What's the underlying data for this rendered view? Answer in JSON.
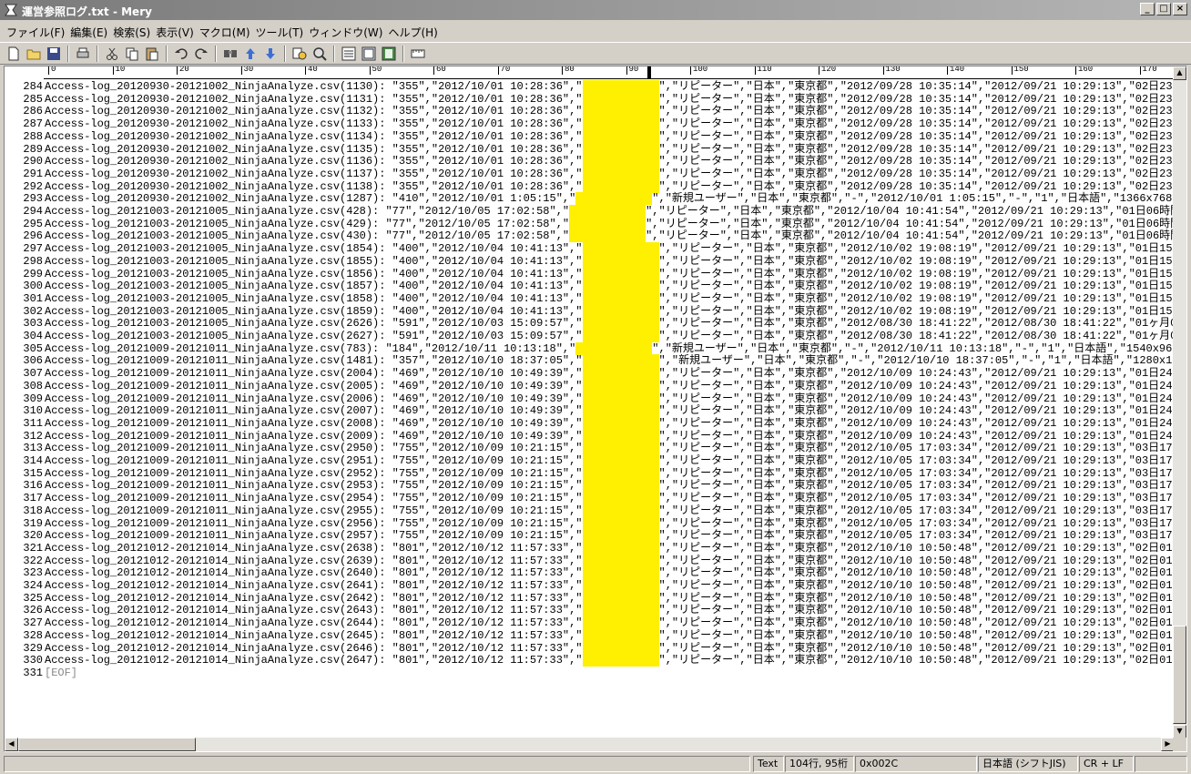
{
  "window": {
    "title": "運営参照ログ.txt - Mery",
    "buttons": [
      "_",
      "□",
      "×"
    ]
  },
  "menu": [
    "ファイル(F)",
    "編集(E)",
    "検索(S)",
    "表示(V)",
    "マクロ(M)",
    "ツール(T)",
    "ウィンドウ(W)",
    "ヘルプ(H)"
  ],
  "toolbar": {
    "icons": [
      "new-file-icon",
      "open-folder-icon",
      "save-icon",
      "print-icon",
      "cut-icon",
      "copy-icon",
      "paste-icon",
      "undo-icon",
      "redo-icon",
      "find-icon",
      "find-prev-icon",
      "find-next-icon",
      "replace-icon",
      "grep-icon",
      "view-icon-1",
      "view-icon-2",
      "view-icon-3",
      "ruler-toggle-icon"
    ]
  },
  "ruler": {
    "labels": [
      "0",
      "10",
      "20",
      "30",
      "40",
      "50",
      "60",
      "70",
      "80",
      "90",
      "100",
      "110",
      "120",
      "130",
      "140",
      "150",
      "160",
      "170"
    ]
  },
  "lines": [
    {
      "no": "284",
      "pre": "Access-log_20120930-20121002_NinjaAnalyze.csv(1130): \"355\",\"2012/10/01 10:28:36\",\"",
      "post": "\",\"リピーター\",\"日本\",\"東京都\",\"2012/09/28 10:35:14\",\"2012/09/21 10:29:13\",\"02日23時"
    },
    {
      "no": "285",
      "pre": "Access-log_20120930-20121002_NinjaAnalyze.csv(1131): \"355\",\"2012/10/01 10:28:36\",\"",
      "post": "\",\"リピーター\",\"日本\",\"東京都\",\"2012/09/28 10:35:14\",\"2012/09/21 10:29:13\",\"02日23時"
    },
    {
      "no": "286",
      "pre": "Access-log_20120930-20121002_NinjaAnalyze.csv(1132): \"355\",\"2012/10/01 10:28:36\",\"",
      "post": "\",\"リピーター\",\"日本\",\"東京都\",\"2012/09/28 10:35:14\",\"2012/09/21 10:29:13\",\"02日23時"
    },
    {
      "no": "287",
      "pre": "Access-log_20120930-20121002_NinjaAnalyze.csv(1133): \"355\",\"2012/10/01 10:28:36\",\"",
      "post": "\",\"リピーター\",\"日本\",\"東京都\",\"2012/09/28 10:35:14\",\"2012/09/21 10:29:13\",\"02日23時"
    },
    {
      "no": "288",
      "pre": "Access-log_20120930-20121002_NinjaAnalyze.csv(1134): \"355\",\"2012/10/01 10:28:36\",\"",
      "post": "\",\"リピーター\",\"日本\",\"東京都\",\"2012/09/28 10:35:14\",\"2012/09/21 10:29:13\",\"02日23時"
    },
    {
      "no": "289",
      "pre": "Access-log_20120930-20121002_NinjaAnalyze.csv(1135): \"355\",\"2012/10/01 10:28:36\",\"",
      "post": "\",\"リピーター\",\"日本\",\"東京都\",\"2012/09/28 10:35:14\",\"2012/09/21 10:29:13\",\"02日23時"
    },
    {
      "no": "290",
      "pre": "Access-log_20120930-20121002_NinjaAnalyze.csv(1136): \"355\",\"2012/10/01 10:28:36\",\"",
      "post": "\",\"リピーター\",\"日本\",\"東京都\",\"2012/09/28 10:35:14\",\"2012/09/21 10:29:13\",\"02日23時"
    },
    {
      "no": "291",
      "pre": "Access-log_20120930-20121002_NinjaAnalyze.csv(1137): \"355\",\"2012/10/01 10:28:36\",\"",
      "post": "\",\"リピーター\",\"日本\",\"東京都\",\"2012/09/28 10:35:14\",\"2012/09/21 10:29:13\",\"02日23時"
    },
    {
      "no": "292",
      "pre": "Access-log_20120930-20121002_NinjaAnalyze.csv(1138): \"355\",\"2012/10/01 10:28:36\",\"",
      "post": "\",\"リピーター\",\"日本\",\"東京都\",\"2012/09/28 10:35:14\",\"2012/09/21 10:29:13\",\"02日23時"
    },
    {
      "no": "293",
      "pre": "Access-log_20120930-20121002_NinjaAnalyze.csv(1287): \"410\",\"2012/10/01 1:05:15\",\"",
      "post": "\",\"新規ユーザー\",\"日本\",\"東京都\",\"-\",\"2012/10/01 1:05:15\",\"-\",\"1\",\"日本語\",\"1366x768"
    },
    {
      "no": "294",
      "pre": "Access-log_20121003-20121005_NinjaAnalyze.csv(428): \"77\",\"2012/10/05 17:02:58\",\"",
      "post": "\",\"リピーター\",\"日本\",\"東京都\",\"2012/10/04 10:41:54\",\"2012/09/21 10:29:13\",\"01日06時間"
    },
    {
      "no": "295",
      "pre": "Access-log_20121003-20121005_NinjaAnalyze.csv(429): \"77\",\"2012/10/05 17:02:58\",\"",
      "post": "\",\"リピーター\",\"日本\",\"東京都\",\"2012/10/04 10:41:54\",\"2012/09/21 10:29:13\",\"01日06時間"
    },
    {
      "no": "296",
      "pre": "Access-log_20121003-20121005_NinjaAnalyze.csv(430): \"77\",\"2012/10/05 17:02:58\",\"",
      "post": "\",\"リピーター\",\"日本\",\"東京都\",\"2012/10/04 10:41:54\",\"2012/09/21 10:29:13\",\"01日06時間"
    },
    {
      "no": "297",
      "pre": "Access-log_20121003-20121005_NinjaAnalyze.csv(1854): \"400\",\"2012/10/04 10:41:13\",\"",
      "post": "\",\"リピーター\",\"日本\",\"東京都\",\"2012/10/02 19:08:19\",\"2012/09/21 10:29:13\",\"01日15時"
    },
    {
      "no": "298",
      "pre": "Access-log_20121003-20121005_NinjaAnalyze.csv(1855): \"400\",\"2012/10/04 10:41:13\",\"",
      "post": "\",\"リピーター\",\"日本\",\"東京都\",\"2012/10/02 19:08:19\",\"2012/09/21 10:29:13\",\"01日15時"
    },
    {
      "no": "299",
      "pre": "Access-log_20121003-20121005_NinjaAnalyze.csv(1856): \"400\",\"2012/10/04 10:41:13\",\"",
      "post": "\",\"リピーター\",\"日本\",\"東京都\",\"2012/10/02 19:08:19\",\"2012/09/21 10:29:13\",\"01日15時"
    },
    {
      "no": "300",
      "pre": "Access-log_20121003-20121005_NinjaAnalyze.csv(1857): \"400\",\"2012/10/04 10:41:13\",\"",
      "post": "\",\"リピーター\",\"日本\",\"東京都\",\"2012/10/02 19:08:19\",\"2012/09/21 10:29:13\",\"01日15時"
    },
    {
      "no": "301",
      "pre": "Access-log_20121003-20121005_NinjaAnalyze.csv(1858): \"400\",\"2012/10/04 10:41:13\",\"",
      "post": "\",\"リピーター\",\"日本\",\"東京都\",\"2012/10/02 19:08:19\",\"2012/09/21 10:29:13\",\"01日15時"
    },
    {
      "no": "302",
      "pre": "Access-log_20121003-20121005_NinjaAnalyze.csv(1859): \"400\",\"2012/10/04 10:41:13\",\"",
      "post": "\",\"リピーター\",\"日本\",\"東京都\",\"2012/10/02 19:08:19\",\"2012/09/21 10:29:13\",\"01日15時"
    },
    {
      "no": "303",
      "pre": "Access-log_20121003-20121005_NinjaAnalyze.csv(2626): \"591\",\"2012/10/03 15:09:57\",\"",
      "post": "\",\"リピーター\",\"日本\",\"東京都\",\"2012/08/30 18:41:22\",\"2012/08/30 18:41:22\",\"01ヶ月0"
    },
    {
      "no": "304",
      "pre": "Access-log_20121003-20121005_NinjaAnalyze.csv(2627): \"591\",\"2012/10/03 15:09:57\",\"",
      "post": "\",\"リピーター\",\"日本\",\"東京都\",\"2012/08/30 18:41:22\",\"2012/08/30 18:41:22\",\"01ヶ月0"
    },
    {
      "no": "305",
      "pre": "Access-log_20121009-20121011_NinjaAnalyze.csv(783): \"184\",\"2012/10/11 10:13:18\",\"",
      "post": "\",\"新規ユーザー\",\"日本\",\"東京都\",\"-\",\"2012/10/11 10:13:18\",\"-\",\"1\",\"日本語\",\"1540x96"
    },
    {
      "no": "306",
      "pre": "Access-log_20121009-20121011_NinjaAnalyze.csv(1481): \"357\",\"2012/10/10 18:37:05\",\"",
      "post": "\",\"新規ユーザー\",\"日本\",\"東京都\",\"-\",\"2012/10/10 18:37:05\",\"-\",\"1\",\"日本語\",\"1280x1"
    },
    {
      "no": "307",
      "pre": "Access-log_20121009-20121011_NinjaAnalyze.csv(2004): \"469\",\"2012/10/10 10:49:39\",\"",
      "post": "\",\"リピーター\",\"日本\",\"東京都\",\"2012/10/09 10:24:43\",\"2012/09/21 10:29:13\",\"01日24分"
    },
    {
      "no": "308",
      "pre": "Access-log_20121009-20121011_NinjaAnalyze.csv(2005): \"469\",\"2012/10/10 10:49:39\",\"",
      "post": "\",\"リピーター\",\"日本\",\"東京都\",\"2012/10/09 10:24:43\",\"2012/09/21 10:29:13\",\"01日24分"
    },
    {
      "no": "309",
      "pre": "Access-log_20121009-20121011_NinjaAnalyze.csv(2006): \"469\",\"2012/10/10 10:49:39\",\"",
      "post": "\",\"リピーター\",\"日本\",\"東京都\",\"2012/10/09 10:24:43\",\"2012/09/21 10:29:13\",\"01日24分"
    },
    {
      "no": "310",
      "pre": "Access-log_20121009-20121011_NinjaAnalyze.csv(2007): \"469\",\"2012/10/10 10:49:39\",\"",
      "post": "\",\"リピーター\",\"日本\",\"東京都\",\"2012/10/09 10:24:43\",\"2012/09/21 10:29:13\",\"01日24分"
    },
    {
      "no": "311",
      "pre": "Access-log_20121009-20121011_NinjaAnalyze.csv(2008): \"469\",\"2012/10/10 10:49:39\",\"",
      "post": "\",\"リピーター\",\"日本\",\"東京都\",\"2012/10/09 10:24:43\",\"2012/09/21 10:29:13\",\"01日24分"
    },
    {
      "no": "312",
      "pre": "Access-log_20121009-20121011_NinjaAnalyze.csv(2009): \"469\",\"2012/10/10 10:49:39\",\"",
      "post": "\",\"リピーター\",\"日本\",\"東京都\",\"2012/10/09 10:24:43\",\"2012/09/21 10:29:13\",\"01日24分"
    },
    {
      "no": "313",
      "pre": "Access-log_20121009-20121011_NinjaAnalyze.csv(2950): \"755\",\"2012/10/09 10:21:15\",\"",
      "post": "\",\"リピーター\",\"日本\",\"東京都\",\"2012/10/05 17:03:34\",\"2012/09/21 10:29:13\",\"03日17時"
    },
    {
      "no": "314",
      "pre": "Access-log_20121009-20121011_NinjaAnalyze.csv(2951): \"755\",\"2012/10/09 10:21:15\",\"",
      "post": "\",\"リピーター\",\"日本\",\"東京都\",\"2012/10/05 17:03:34\",\"2012/09/21 10:29:13\",\"03日17時"
    },
    {
      "no": "315",
      "pre": "Access-log_20121009-20121011_NinjaAnalyze.csv(2952): \"755\",\"2012/10/09 10:21:15\",\"",
      "post": "\",\"リピーター\",\"日本\",\"東京都\",\"2012/10/05 17:03:34\",\"2012/09/21 10:29:13\",\"03日17時"
    },
    {
      "no": "316",
      "pre": "Access-log_20121009-20121011_NinjaAnalyze.csv(2953): \"755\",\"2012/10/09 10:21:15\",\"",
      "post": "\",\"リピーター\",\"日本\",\"東京都\",\"2012/10/05 17:03:34\",\"2012/09/21 10:29:13\",\"03日17時"
    },
    {
      "no": "317",
      "pre": "Access-log_20121009-20121011_NinjaAnalyze.csv(2954): \"755\",\"2012/10/09 10:21:15\",\"",
      "post": "\",\"リピーター\",\"日本\",\"東京都\",\"2012/10/05 17:03:34\",\"2012/09/21 10:29:13\",\"03日17時"
    },
    {
      "no": "318",
      "pre": "Access-log_20121009-20121011_NinjaAnalyze.csv(2955): \"755\",\"2012/10/09 10:21:15\",\"",
      "post": "\",\"リピーター\",\"日本\",\"東京都\",\"2012/10/05 17:03:34\",\"2012/09/21 10:29:13\",\"03日17時"
    },
    {
      "no": "319",
      "pre": "Access-log_20121009-20121011_NinjaAnalyze.csv(2956): \"755\",\"2012/10/09 10:21:15\",\"",
      "post": "\",\"リピーター\",\"日本\",\"東京都\",\"2012/10/05 17:03:34\",\"2012/09/21 10:29:13\",\"03日17時"
    },
    {
      "no": "320",
      "pre": "Access-log_20121009-20121011_NinjaAnalyze.csv(2957): \"755\",\"2012/10/09 10:21:15\",\"",
      "post": "\",\"リピーター\",\"日本\",\"東京都\",\"2012/10/05 17:03:34\",\"2012/09/21 10:29:13\",\"03日17時"
    },
    {
      "no": "321",
      "pre": "Access-log_20121012-20121014_NinjaAnalyze.csv(2638): \"801\",\"2012/10/12 11:57:33\",\"",
      "post": "\",\"リピーター\",\"日本\",\"東京都\",\"2012/10/10 10:50:48\",\"2012/09/21 10:29:13\",\"02日01時"
    },
    {
      "no": "322",
      "pre": "Access-log_20121012-20121014_NinjaAnalyze.csv(2639): \"801\",\"2012/10/12 11:57:33\",\"",
      "post": "\",\"リピーター\",\"日本\",\"東京都\",\"2012/10/10 10:50:48\",\"2012/09/21 10:29:13\",\"02日01時"
    },
    {
      "no": "323",
      "pre": "Access-log_20121012-20121014_NinjaAnalyze.csv(2640): \"801\",\"2012/10/12 11:57:33\",\"",
      "post": "\",\"リピーター\",\"日本\",\"東京都\",\"2012/10/10 10:50:48\",\"2012/09/21 10:29:13\",\"02日01時"
    },
    {
      "no": "324",
      "pre": "Access-log_20121012-20121014_NinjaAnalyze.csv(2641): \"801\",\"2012/10/12 11:57:33\",\"",
      "post": "\",\"リピーター\",\"日本\",\"東京都\",\"2012/10/10 10:50:48\",\"2012/09/21 10:29:13\",\"02日01時"
    },
    {
      "no": "325",
      "pre": "Access-log_20121012-20121014_NinjaAnalyze.csv(2642): \"801\",\"2012/10/12 11:57:33\",\"",
      "post": "\",\"リピーター\",\"日本\",\"東京都\",\"2012/10/10 10:50:48\",\"2012/09/21 10:29:13\",\"02日01時"
    },
    {
      "no": "326",
      "pre": "Access-log_20121012-20121014_NinjaAnalyze.csv(2643): \"801\",\"2012/10/12 11:57:33\",\"",
      "post": "\",\"リピーター\",\"日本\",\"東京都\",\"2012/10/10 10:50:48\",\"2012/09/21 10:29:13\",\"02日01時"
    },
    {
      "no": "327",
      "pre": "Access-log_20121012-20121014_NinjaAnalyze.csv(2644): \"801\",\"2012/10/12 11:57:33\",\"",
      "post": "\",\"リピーター\",\"日本\",\"東京都\",\"2012/10/10 10:50:48\",\"2012/09/21 10:29:13\",\"02日01時"
    },
    {
      "no": "328",
      "pre": "Access-log_20121012-20121014_NinjaAnalyze.csv(2645): \"801\",\"2012/10/12 11:57:33\",\"",
      "post": "\",\"リピーター\",\"日本\",\"東京都\",\"2012/10/10 10:50:48\",\"2012/09/21 10:29:13\",\"02日01時"
    },
    {
      "no": "329",
      "pre": "Access-log_20121012-20121014_NinjaAnalyze.csv(2646): \"801\",\"2012/10/12 11:57:33\",\"",
      "post": "\",\"リピーター\",\"日本\",\"東京都\",\"2012/10/10 10:50:48\",\"2012/09/21 10:29:13\",\"02日01時"
    },
    {
      "no": "330",
      "pre": "Access-log_20121012-20121014_NinjaAnalyze.csv(2647): \"801\",\"2012/10/12 11:57:33\",\"",
      "post": "\",\"リピーター\",\"日本\",\"東京都\",\"2012/10/10 10:50:48\",\"2012/09/21 10:29:13\",\"02日01時"
    },
    {
      "no": "331",
      "pre": "[EOF]",
      "post": "",
      "eof": true
    }
  ],
  "highlight_color": "#ffef00",
  "status": {
    "mode": "Text",
    "position": "104行, 95桁",
    "char_code": "0x002C",
    "encoding": "日本語 (シフトJIS)",
    "line_ending": "CR + LF"
  }
}
